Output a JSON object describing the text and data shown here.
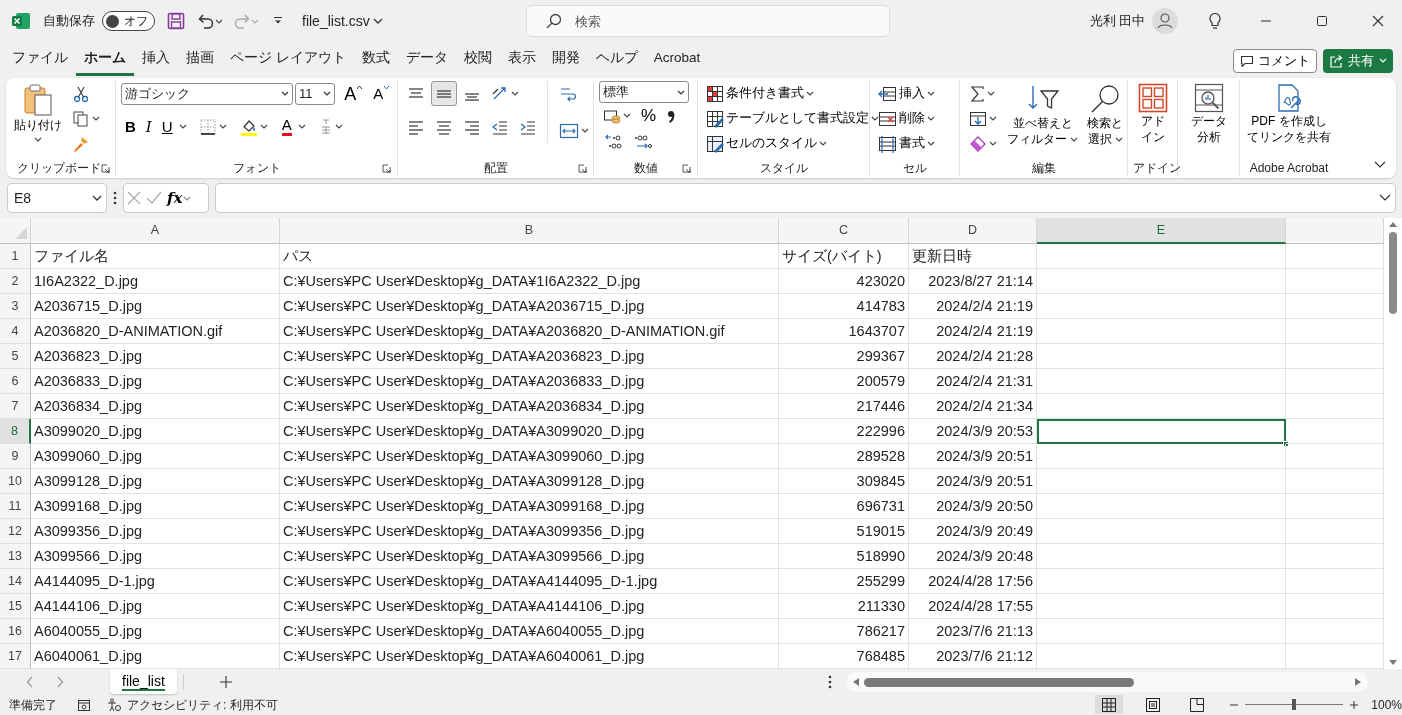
{
  "titlebar": {
    "autosave": {
      "label": "自動保存",
      "state": "オフ",
      "on": false
    },
    "filename": "file_list.csv",
    "search": {
      "placeholder": "検索"
    },
    "user": "光利 田中"
  },
  "menu_tabs": [
    {
      "label": "ファイル",
      "selected": false
    },
    {
      "label": "ホーム",
      "selected": true
    },
    {
      "label": "挿入",
      "selected": false
    },
    {
      "label": "描画",
      "selected": false
    },
    {
      "label": "ページ レイアウト",
      "selected": false
    },
    {
      "label": "数式",
      "selected": false
    },
    {
      "label": "データ",
      "selected": false
    },
    {
      "label": "校閲",
      "selected": false
    },
    {
      "label": "表示",
      "selected": false
    },
    {
      "label": "開発",
      "selected": false
    },
    {
      "label": "ヘルプ",
      "selected": false
    },
    {
      "label": "Acrobat",
      "selected": false
    }
  ],
  "comment_button": "コメント",
  "share_button": "共有",
  "ribbon": {
    "clipboard": {
      "paste": "貼り付け",
      "label": "クリップボード"
    },
    "font": {
      "font_name": "游ゴシック",
      "font_size": "11",
      "grow": "A",
      "shrink": "A",
      "bold": "B",
      "italic": "I",
      "underline": "U",
      "font_color": "A",
      "label": "フォント"
    },
    "alignment": {
      "vertical": [
        {
          "selected": false
        },
        {
          "selected": true
        },
        {
          "selected": false
        }
      ],
      "label": "配置"
    },
    "number": {
      "format": "標準",
      "percent": "%",
      "label": "数値"
    },
    "styles": {
      "items": [
        "条件付き書式",
        "テーブルとして書式設定",
        "セルのスタイル"
      ],
      "label": "スタイル"
    },
    "cells": {
      "items": [
        "挿入",
        "削除",
        "書式"
      ],
      "label": "セル"
    },
    "editing": {
      "sort": [
        "並べ替えと",
        "フィルター"
      ],
      "find": [
        "検索と",
        "選択"
      ],
      "label": "編集"
    },
    "addins": {
      "button": [
        "アド",
        "イン"
      ],
      "label": "アドイン"
    },
    "analysis": {
      "button": [
        "データ",
        "分析"
      ]
    },
    "acrobat": {
      "button": [
        "PDF を作成し",
        "てリンクを共有"
      ],
      "label": "Adobe Acrobat"
    }
  },
  "formula_bar": {
    "name_box": "E8",
    "function_label": "fx"
  },
  "columns": [
    {
      "label": "A",
      "selected": false
    },
    {
      "label": "B",
      "selected": false
    },
    {
      "label": "C",
      "selected": false
    },
    {
      "label": "D",
      "selected": false
    },
    {
      "label": "E",
      "selected": true
    }
  ],
  "rows": [
    {
      "number": "1",
      "selected": false,
      "cells": [
        "ファイル名",
        "パス",
        "サイズ(バイト)",
        "更新日時"
      ]
    },
    {
      "number": "2",
      "selected": false,
      "cells": [
        "1I6A2322_D.jpg",
        "C:¥Users¥PC User¥Desktop¥g_DATA¥1I6A2322_D.jpg",
        "423020",
        "2023/8/27 21:14"
      ]
    },
    {
      "number": "3",
      "selected": false,
      "cells": [
        "A2036715_D.jpg",
        "C:¥Users¥PC User¥Desktop¥g_DATA¥A2036715_D.jpg",
        "414783",
        "2024/2/4 21:19"
      ]
    },
    {
      "number": "4",
      "selected": false,
      "cells": [
        "A2036820_D-ANIMATION.gif",
        "C:¥Users¥PC User¥Desktop¥g_DATA¥A2036820_D-ANIMATION.gif",
        "1643707",
        "2024/2/4 21:19"
      ]
    },
    {
      "number": "5",
      "selected": false,
      "cells": [
        "A2036823_D.jpg",
        "C:¥Users¥PC User¥Desktop¥g_DATA¥A2036823_D.jpg",
        "299367",
        "2024/2/4 21:28"
      ]
    },
    {
      "number": "6",
      "selected": false,
      "cells": [
        "A2036833_D.jpg",
        "C:¥Users¥PC User¥Desktop¥g_DATA¥A2036833_D.jpg",
        "200579",
        "2024/2/4 21:31"
      ]
    },
    {
      "number": "7",
      "selected": false,
      "cells": [
        "A2036834_D.jpg",
        "C:¥Users¥PC User¥Desktop¥g_DATA¥A2036834_D.jpg",
        "217446",
        "2024/2/4 21:34"
      ]
    },
    {
      "number": "8",
      "selected": true,
      "cells": [
        "A3099020_D.jpg",
        "C:¥Users¥PC User¥Desktop¥g_DATA¥A3099020_D.jpg",
        "222996",
        "2024/3/9 20:53"
      ]
    },
    {
      "number": "9",
      "selected": false,
      "cells": [
        "A3099060_D.jpg",
        "C:¥Users¥PC User¥Desktop¥g_DATA¥A3099060_D.jpg",
        "289528",
        "2024/3/9 20:51"
      ]
    },
    {
      "number": "10",
      "selected": false,
      "cells": [
        "A3099128_D.jpg",
        "C:¥Users¥PC User¥Desktop¥g_DATA¥A3099128_D.jpg",
        "309845",
        "2024/3/9 20:51"
      ]
    },
    {
      "number": "11",
      "selected": false,
      "cells": [
        "A3099168_D.jpg",
        "C:¥Users¥PC User¥Desktop¥g_DATA¥A3099168_D.jpg",
        "696731",
        "2024/3/9 20:50"
      ]
    },
    {
      "number": "12",
      "selected": false,
      "cells": [
        "A3099356_D.jpg",
        "C:¥Users¥PC User¥Desktop¥g_DATA¥A3099356_D.jpg",
        "519015",
        "2024/3/9 20:49"
      ]
    },
    {
      "number": "13",
      "selected": false,
      "cells": [
        "A3099566_D.jpg",
        "C:¥Users¥PC User¥Desktop¥g_DATA¥A3099566_D.jpg",
        "518990",
        "2024/3/9 20:48"
      ]
    },
    {
      "number": "14",
      "selected": false,
      "cells": [
        "A4144095_D-1.jpg",
        "C:¥Users¥PC User¥Desktop¥g_DATA¥A4144095_D-1.jpg",
        "255299",
        "2024/4/28 17:56"
      ]
    },
    {
      "number": "15",
      "selected": false,
      "cells": [
        "A4144106_D.jpg",
        "C:¥Users¥PC User¥Desktop¥g_DATA¥A4144106_D.jpg",
        "211330",
        "2024/4/28 17:55"
      ]
    },
    {
      "number": "16",
      "selected": false,
      "cells": [
        "A6040055_D.jpg",
        "C:¥Users¥PC User¥Desktop¥g_DATA¥A6040055_D.jpg",
        "786217",
        "2023/7/6 21:13"
      ]
    },
    {
      "number": "17",
      "selected": false,
      "cells": [
        "A6040061_D.jpg",
        "C:¥Users¥PC User¥Desktop¥g_DATA¥A6040061_D.jpg",
        "768485",
        "2023/7/6 21:12"
      ]
    }
  ],
  "sheet_tabs": [
    {
      "label": "file_list",
      "selected": true
    }
  ],
  "status_bar": {
    "ready": "準備完了",
    "accessibility": "アクセシビリティ: 利用不可",
    "views": [
      {
        "selected": true
      },
      {
        "selected": false
      },
      {
        "selected": false
      }
    ],
    "zoom": {
      "level": 0.5,
      "label": "100%"
    }
  }
}
